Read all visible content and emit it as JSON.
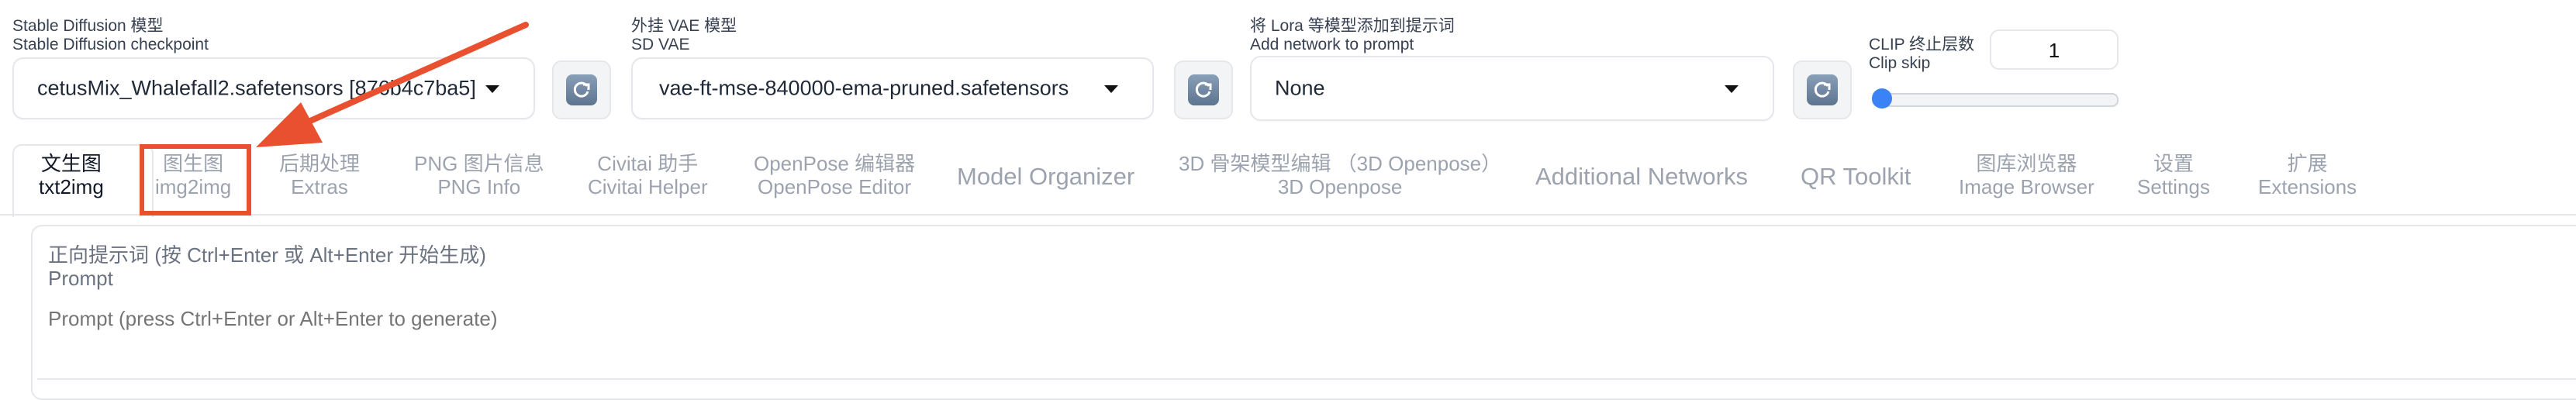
{
  "header": {
    "checkpoint": {
      "label_cn": "Stable Diffusion 模型",
      "label_en": "Stable Diffusion checkpoint",
      "value": "cetusMix_Whalefall2.safetensors [876b4c7ba5]"
    },
    "vae": {
      "label_cn": "外挂 VAE 模型",
      "label_en": "SD VAE",
      "value": "vae-ft-mse-840000-ema-pruned.safetensors"
    },
    "lora": {
      "label_cn": "将 Lora 等模型添加到提示词",
      "label_en": "Add network to prompt",
      "value": "None"
    },
    "clip": {
      "label_cn": "CLIP 终止层数",
      "label_en": "Clip skip",
      "value": "1",
      "slider_fraction": 0.0
    }
  },
  "tabs": [
    {
      "cn": "文生图",
      "en": "txt2img",
      "active": true
    },
    {
      "cn": "图生图",
      "en": "img2img",
      "highlighted": true
    },
    {
      "cn": "后期处理",
      "en": "Extras"
    },
    {
      "cn": "PNG 图片信息",
      "en": "PNG Info"
    },
    {
      "cn": "Civitai 助手",
      "en": "Civitai Helper"
    },
    {
      "cn": "OpenPose 编辑器",
      "en": "OpenPose Editor"
    },
    {
      "cn": "Model Organizer",
      "en": ""
    },
    {
      "cn": "3D 骨架模型编辑 （3D Openpose）",
      "en": "3D Openpose"
    },
    {
      "cn": "Additional Networks",
      "en": ""
    },
    {
      "cn": "QR Toolkit",
      "en": ""
    },
    {
      "cn": "图库浏览器",
      "en": "Image Browser"
    },
    {
      "cn": "设置",
      "en": "Settings"
    },
    {
      "cn": "扩展",
      "en": "Extensions"
    }
  ],
  "prompt": {
    "label_cn": "正向提示词 (按 Ctrl+Enter 或 Alt+Enter 开始生成)",
    "label_en": "Prompt",
    "placeholder": "Prompt (press Ctrl+Enter or Alt+Enter to generate)"
  },
  "colors": {
    "annotation": "#e8502f",
    "slider": "#3b82f6"
  },
  "icons": {
    "refresh": "refresh-icon",
    "dropdown": "chevron-down-icon"
  }
}
